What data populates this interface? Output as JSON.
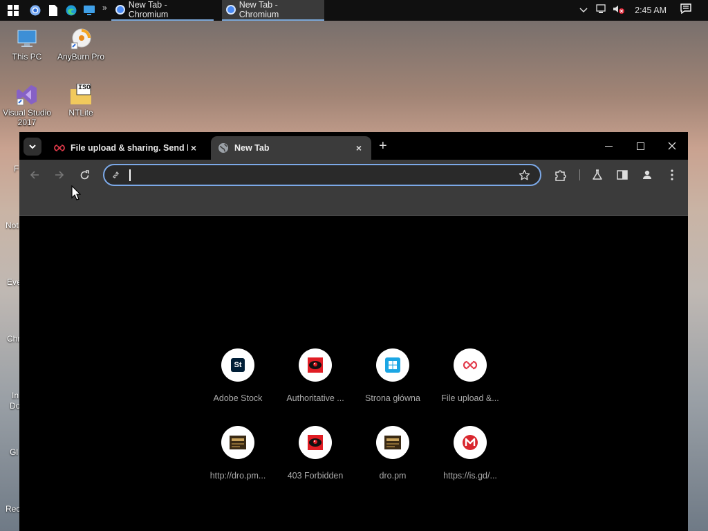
{
  "taskbar": {
    "tasks": [
      {
        "label": "New Tab - Chromium"
      },
      {
        "label": "New Tab - Chromium"
      }
    ],
    "more_label": "»",
    "clock": "2:45 AM"
  },
  "desktop": {
    "icons": [
      {
        "label": "This PC"
      },
      {
        "label": "AnyBurn Pro"
      },
      {
        "label": "Visual Studio 2017"
      },
      {
        "label": "NTLite"
      }
    ],
    "iso_label": "ISO",
    "edge_labels": [
      "F",
      "Not",
      "Eve",
      "Chr",
      "In",
      "Do",
      "Gl",
      "Rec"
    ]
  },
  "browser": {
    "tabs": [
      {
        "title": "File upload & sharing. Send lar",
        "close": "×"
      },
      {
        "title": "New Tab",
        "close": "×"
      }
    ],
    "new_tab_label": "+",
    "omnibox": {
      "value": "",
      "placeholder": ""
    }
  },
  "shortcuts": [
    {
      "label": "Adobe Stock",
      "icon_text": "St"
    },
    {
      "label": "Authoritative ..."
    },
    {
      "label": "Strona główna"
    },
    {
      "label": "File upload &..."
    },
    {
      "label": "http://dro.pm..."
    },
    {
      "label": "403 Forbidden"
    },
    {
      "label": "dro.pm"
    },
    {
      "label": "https://is.gd/..."
    }
  ]
}
